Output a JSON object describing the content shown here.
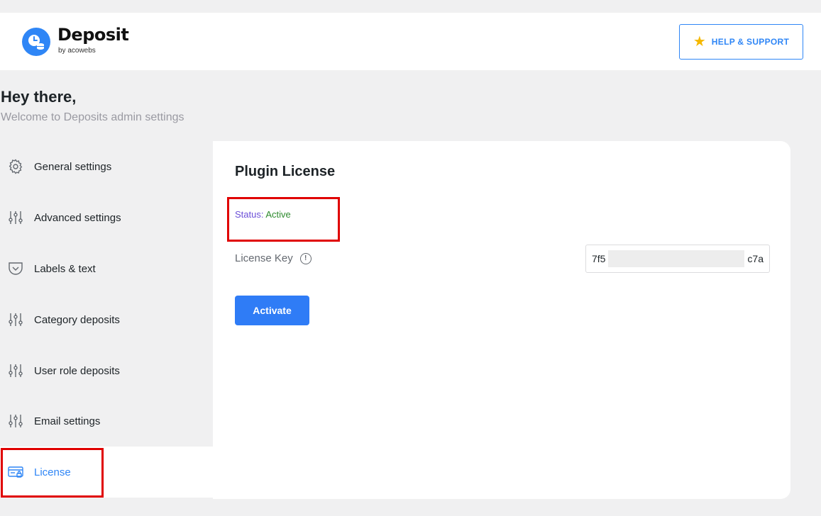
{
  "header": {
    "logo_title": "Deposit",
    "logo_subtitle": "by acowebs",
    "help_label": "HELP & SUPPORT"
  },
  "intro": {
    "greeting": "Hey there,",
    "welcome": "Welcome to Deposits admin settings"
  },
  "sidebar": {
    "items": [
      {
        "label": "General settings",
        "icon": "gear-icon"
      },
      {
        "label": "Advanced settings",
        "icon": "sliders-icon"
      },
      {
        "label": "Labels & text",
        "icon": "pocket-icon"
      },
      {
        "label": "Category deposits",
        "icon": "sliders-icon"
      },
      {
        "label": "User role deposits",
        "icon": "sliders-icon"
      },
      {
        "label": "Email settings",
        "icon": "sliders-icon"
      },
      {
        "label": "License",
        "icon": "license-card-icon",
        "active": true
      }
    ]
  },
  "panel": {
    "title": "Plugin License",
    "status_label": "Status:",
    "status_value": "Active",
    "license_key_label": "License Key",
    "license_key_prefix": "7f5",
    "license_key_suffix": "c7a",
    "activate_label": "Activate"
  },
  "colors": {
    "accent": "#2f86f6",
    "button": "#2f7cf6",
    "status_active": "#2d8a2d",
    "status_label": "#6b4fd8",
    "highlight": "#e00000",
    "star": "#f5b800"
  }
}
